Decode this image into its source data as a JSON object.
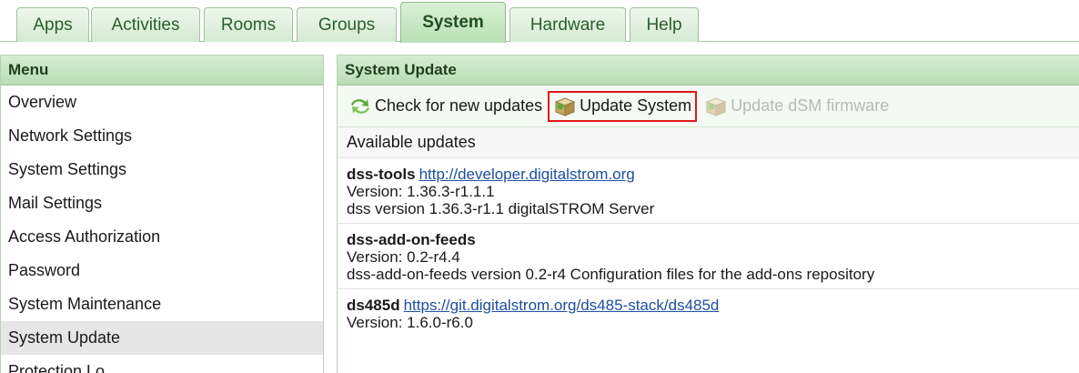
{
  "tabs": [
    {
      "label": "Apps"
    },
    {
      "label": "Activities"
    },
    {
      "label": "Rooms"
    },
    {
      "label": "Groups"
    },
    {
      "label": "System",
      "active": true
    },
    {
      "label": "Hardware"
    },
    {
      "label": "Help"
    }
  ],
  "sidebar": {
    "title": "Menu",
    "items": [
      {
        "label": "Overview"
      },
      {
        "label": "Network Settings"
      },
      {
        "label": "System Settings"
      },
      {
        "label": "Mail Settings"
      },
      {
        "label": "Access Authorization"
      },
      {
        "label": "Password"
      },
      {
        "label": "System Maintenance"
      },
      {
        "label": "System Update",
        "selected": true
      },
      {
        "label": "Protection Lo..."
      }
    ]
  },
  "main": {
    "title": "System Update",
    "toolbar": {
      "check_label": "Check for new updates",
      "update_system_label": "Update System",
      "update_dsm_label": "Update dSM firmware"
    },
    "section_title": "Available updates",
    "packages": [
      {
        "name": "dss-tools",
        "link": "http://developer.digitalstrom.org",
        "version": "Version: 1.36.3-r1.1.1",
        "description": "dss version 1.36.3-r1.1 digitalSTROM Server"
      },
      {
        "name": "dss-add-on-feeds",
        "link": "",
        "version": "Version: 0.2-r4.4",
        "description": "dss-add-on-feeds version 0.2-r4 Configuration files for the add-ons repository"
      },
      {
        "name": "ds485d",
        "link": "https://git.digitalstrom.org/ds485-stack/ds485d",
        "version": "Version: 1.6.0-r6.0",
        "description": ""
      }
    ]
  },
  "colors": {
    "accent_green": "#b9dcb5",
    "highlight_red": "#e0161b",
    "link_blue": "#1d4fa0"
  },
  "icons": {
    "check": "refresh-arrows-icon",
    "update_system": "package-box-icon",
    "update_dsm": "package-box-icon"
  }
}
